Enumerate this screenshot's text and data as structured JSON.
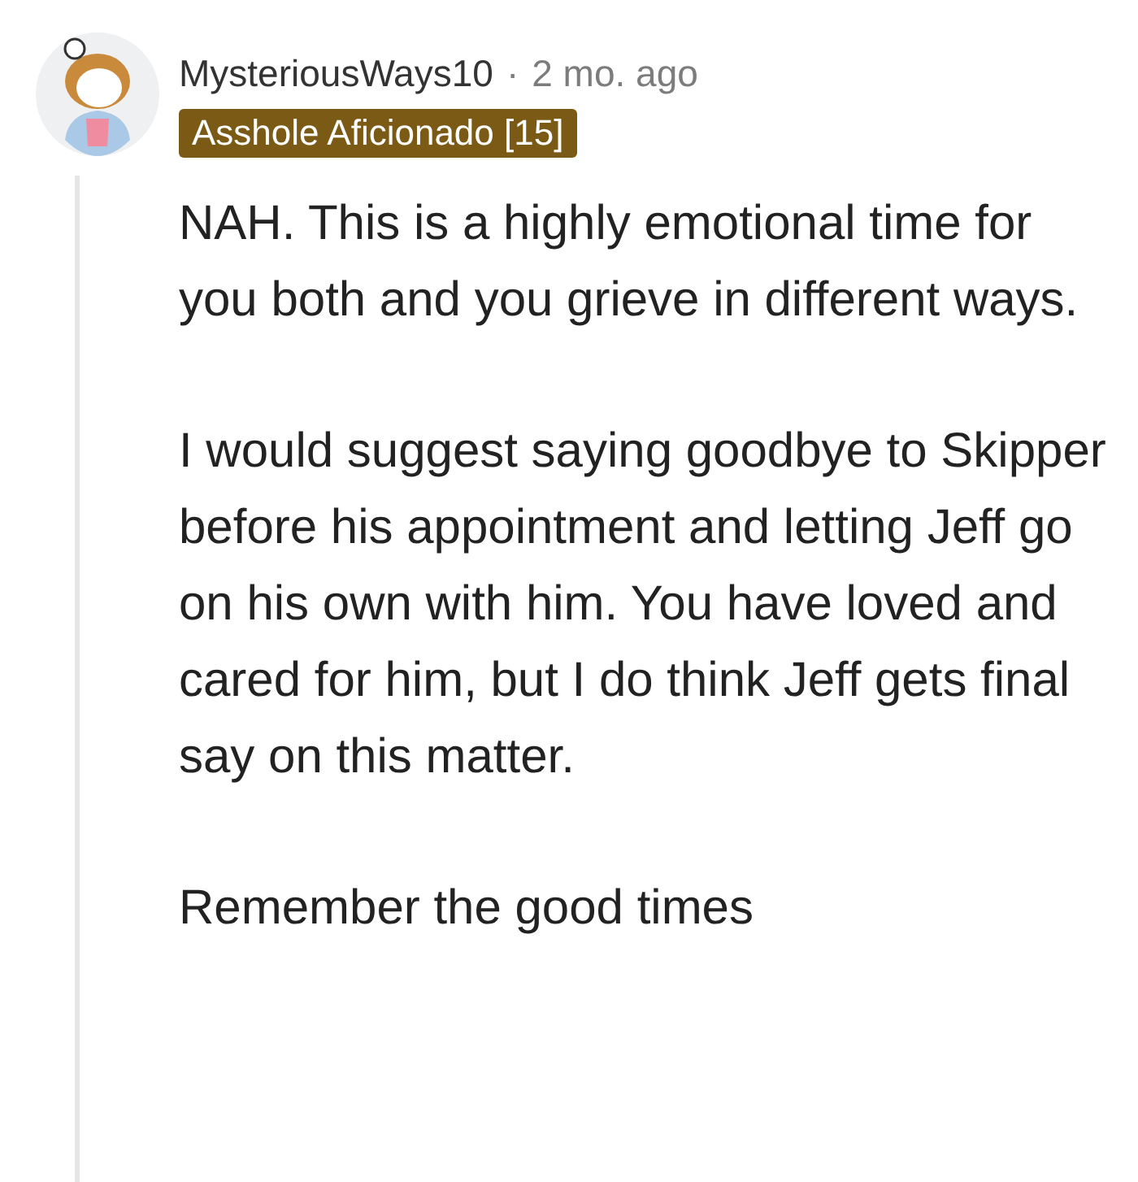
{
  "comment": {
    "author": "MysteriousWays10",
    "separator": "·",
    "time": "2 mo. ago",
    "flair": "Asshole Aficionado [15]",
    "paragraphs": [
      "NAH. This is a highly emotional time for you both and you grieve in different ways.",
      "I would suggest saying goodbye to Skipper before his appointment and letting Jeff go on his own with him. You have loved and cared for him, but I do think Jeff gets final say on this matter.",
      "Remember the good times"
    ]
  }
}
